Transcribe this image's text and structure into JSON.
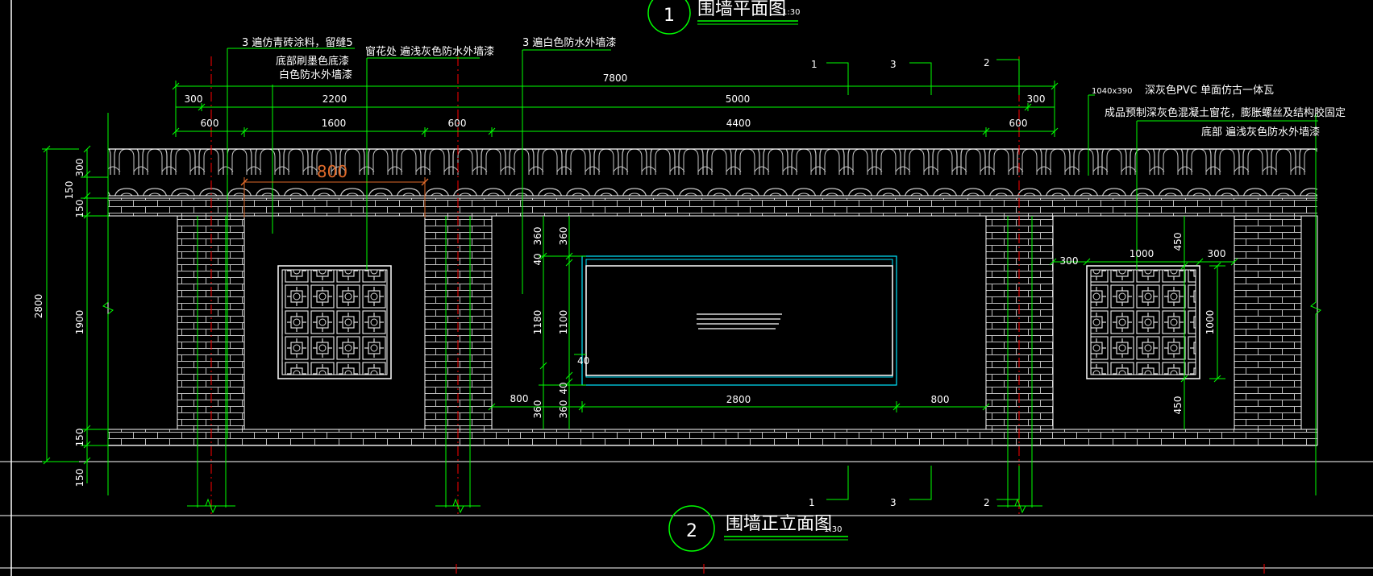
{
  "colors": {
    "background": "#000000",
    "green": "#00ff00",
    "red": "#ff0000",
    "white": "#ffffff",
    "cyan": "#00e5ff",
    "orange": "#e06a2a",
    "grey": "#9a9a9a"
  },
  "titles": {
    "plan": {
      "number": "1",
      "text": "围墙平面图",
      "scale": "1:30"
    },
    "elevation": {
      "number": "2",
      "text": "围墙正立面图",
      "scale": "1:30"
    }
  },
  "section_marks": {
    "one": "1",
    "two": "2",
    "three": "3"
  },
  "annotations": {
    "left_1": "3 遍仿青砖涂料，留缝5",
    "left_2": "底部刷墨色底漆",
    "left_3": "白色防水外墙漆",
    "window": "窗花处 遍浅灰色防水外墙漆",
    "center": "3 遍白色防水外墙漆",
    "tile_size": "1040x390",
    "tile": "深灰色PVC 单面仿古一体瓦",
    "window_right": "成品预制深灰色混凝土窗花，膨胀螺丝及结构胶固定",
    "base_right": "底部 遍浅灰色防水外墙漆"
  },
  "dimensions": {
    "total": "7800",
    "row2": [
      "300",
      "2200",
      "5000",
      "300"
    ],
    "row3": [
      "600",
      "1600",
      "600",
      "4400",
      "600"
    ],
    "orange": "800",
    "left_vertical": [
      "300",
      "150",
      "150",
      "1900",
      "150",
      "150"
    ],
    "overall_height": "2800",
    "center_vertical_a": [
      "360",
      "40",
      "1180",
      "40",
      "360"
    ],
    "center_vertical_b": [
      "360",
      "1100",
      "360"
    ],
    "center_inner": "40",
    "center_bottom": [
      "800",
      "2800",
      "800"
    ],
    "right_panel": [
      "300",
      "1000",
      "300"
    ],
    "right_vertical": [
      "450",
      "1000",
      "450"
    ]
  }
}
